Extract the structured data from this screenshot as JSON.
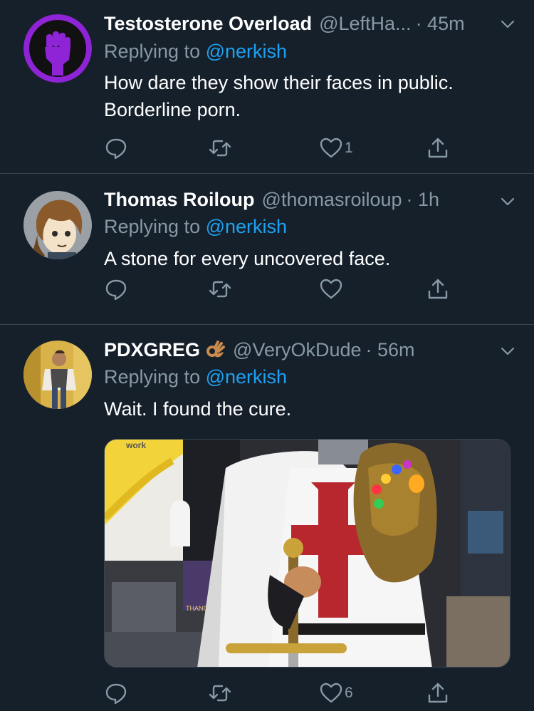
{
  "tweets": [
    {
      "name": "Testosterone Overload",
      "handle": "@LeftHa...",
      "time": "· 45m",
      "replying_prefix": "Replying to ",
      "replying_to": "@nerkish",
      "text": "How dare they show their faces in public. Borderline porn.",
      "like_count": "1",
      "avatar_icon": "raised-fist-icon"
    },
    {
      "name": "Thomas Roiloup",
      "handle": "@thomasroiloup",
      "time": "· 1h",
      "replying_prefix": "Replying to ",
      "replying_to": "@nerkish",
      "text": "A stone for every uncovered face.",
      "like_count": "",
      "avatar_icon": "cartoon-face-avatar"
    },
    {
      "name": "PDXGREG",
      "handle": "@VeryOkDude",
      "time": "· 56m",
      "replying_prefix": "Replying to ",
      "replying_to": "@nerkish",
      "text": "Wait. I found the cure.",
      "like_count": "6",
      "avatar_icon": "person-photo-avatar",
      "name_emoji": "ok-hand-icon",
      "media": {
        "description_icon": "knight-templar-costume-photo",
        "sign_text": "work",
        "box_text": "THANOS"
      }
    }
  ],
  "colors": {
    "background": "#15202b",
    "secondary_text": "#8899a6",
    "link": "#1da1f2",
    "divider": "#38444d",
    "avatar_purple": "#8e24d6"
  }
}
